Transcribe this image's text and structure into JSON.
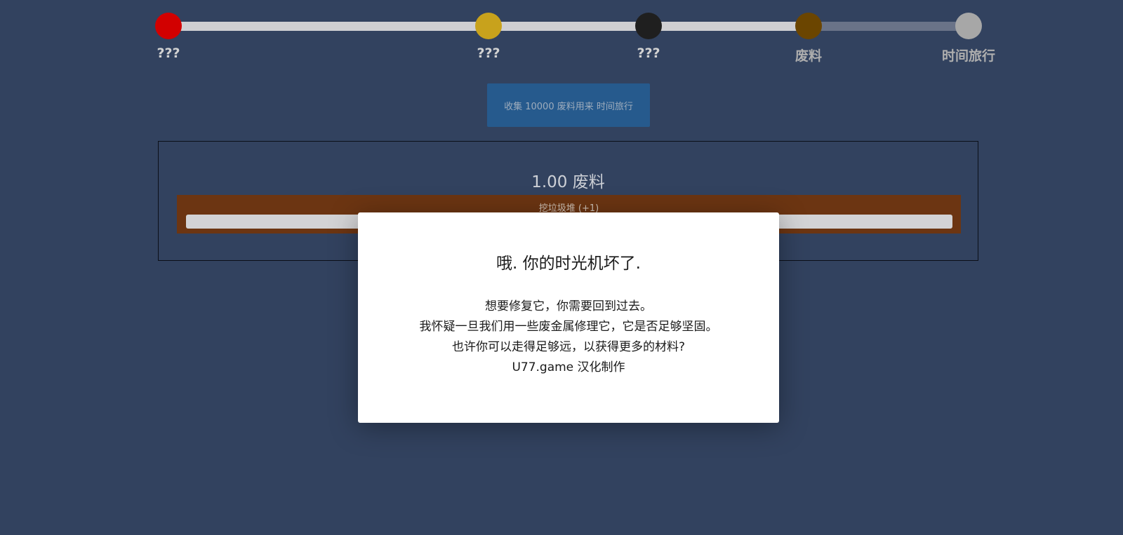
{
  "progress": {
    "nodes": [
      {
        "label": "???",
        "color": "#d20000",
        "state": "done"
      },
      {
        "label": "???",
        "color": "#c8a21c",
        "state": "done"
      },
      {
        "label": "???",
        "color": "#1f1f1f",
        "state": "done"
      },
      {
        "label": "废料",
        "color": "#6b4500",
        "state": "current"
      },
      {
        "label": "时间旅行",
        "color": "#a7a7a7",
        "state": "locked"
      }
    ]
  },
  "goal_button": {
    "label": "收集 10000 废料用来 时间旅行"
  },
  "resource": {
    "amount": "1.00 废料"
  },
  "action": {
    "label": "挖垃圾堆 (+1)",
    "progress": 0
  },
  "modal": {
    "title": "哦. 你的时光机坏了.",
    "lines": [
      "想要修复它，你需要回到过去。",
      "我怀疑一旦我们用一些废金属修理它，它是否足够坚固。",
      "也许你可以走得足够远，以获得更多的材料?",
      "U77.game 汉化制作"
    ]
  },
  "colors": {
    "background": "#32425f",
    "goal_button": "#265a8d",
    "action_bar": "#6c3512"
  }
}
